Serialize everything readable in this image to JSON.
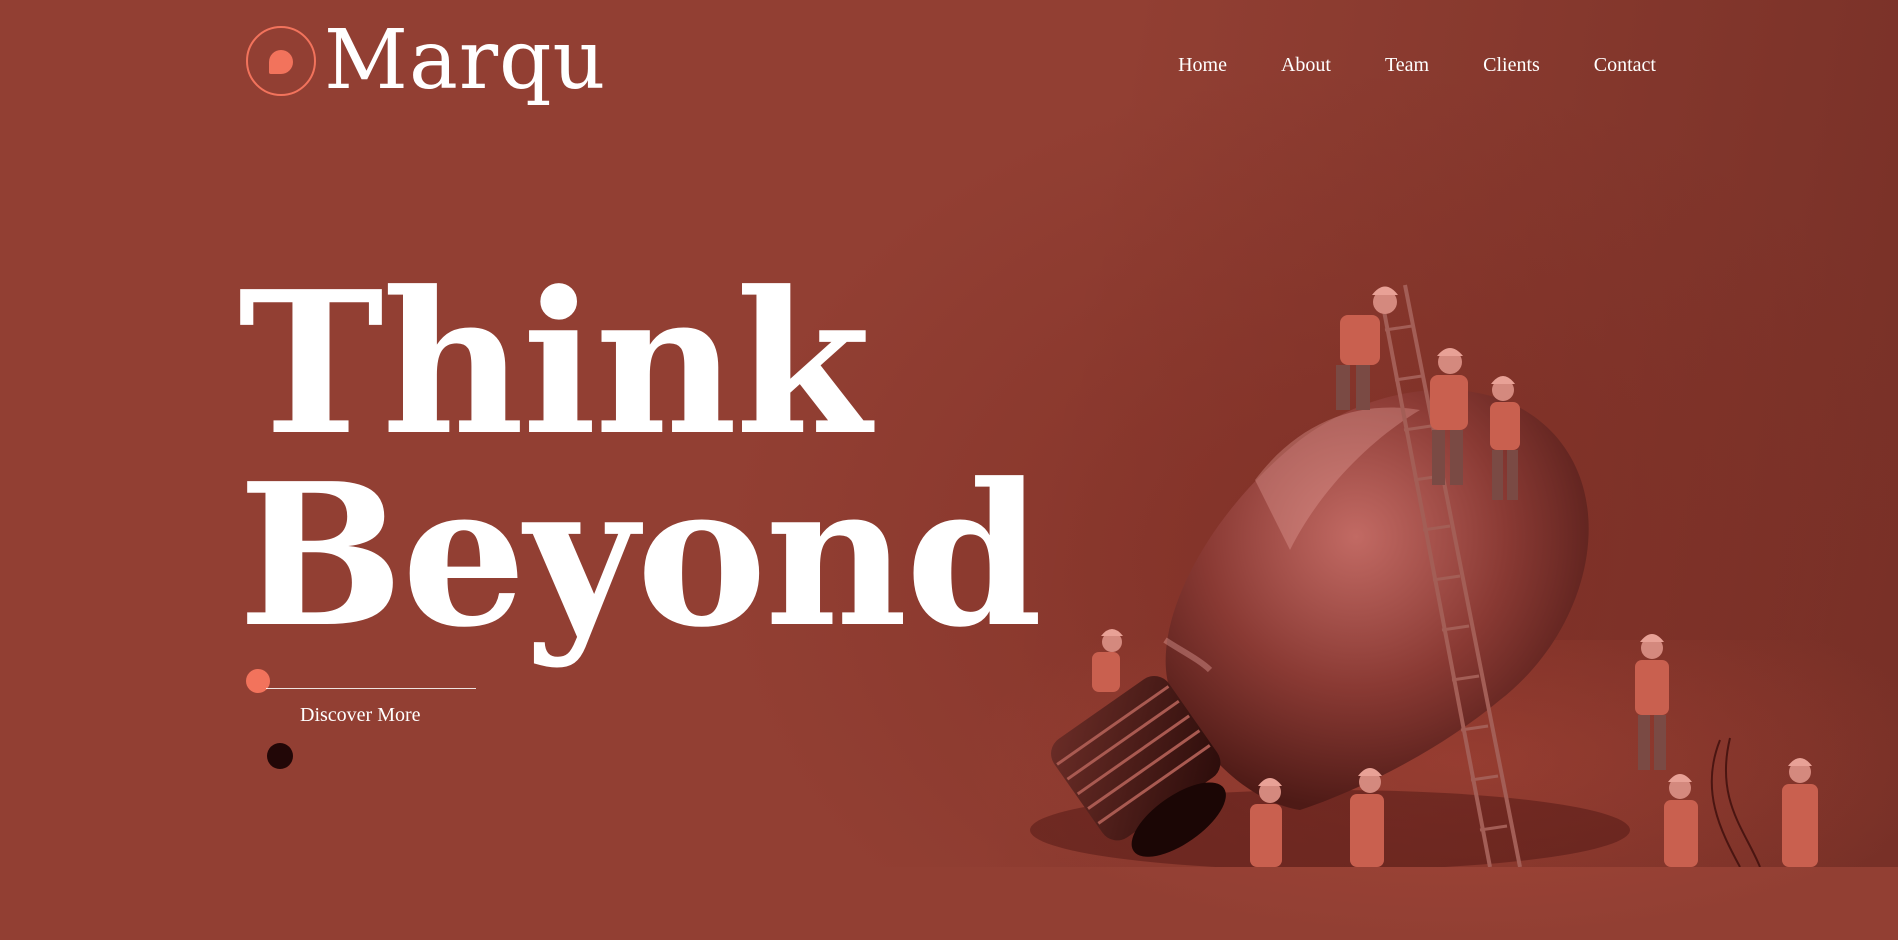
{
  "brand": {
    "name": "Marqu",
    "icon": "speech-bubble-icon",
    "accent": "#f2735c"
  },
  "nav": {
    "items": [
      {
        "label": "Home"
      },
      {
        "label": "About"
      },
      {
        "label": "Team"
      },
      {
        "label": "Clients"
      },
      {
        "label": "Contact"
      }
    ]
  },
  "hero": {
    "line1": "Think",
    "line2": "Beyond",
    "cta_label": "Discover More",
    "illustration": "lightbulb-with-workers-illustration"
  },
  "colors": {
    "background": "#923f33",
    "text": "#ffffff",
    "dark_dot": "#220707"
  }
}
